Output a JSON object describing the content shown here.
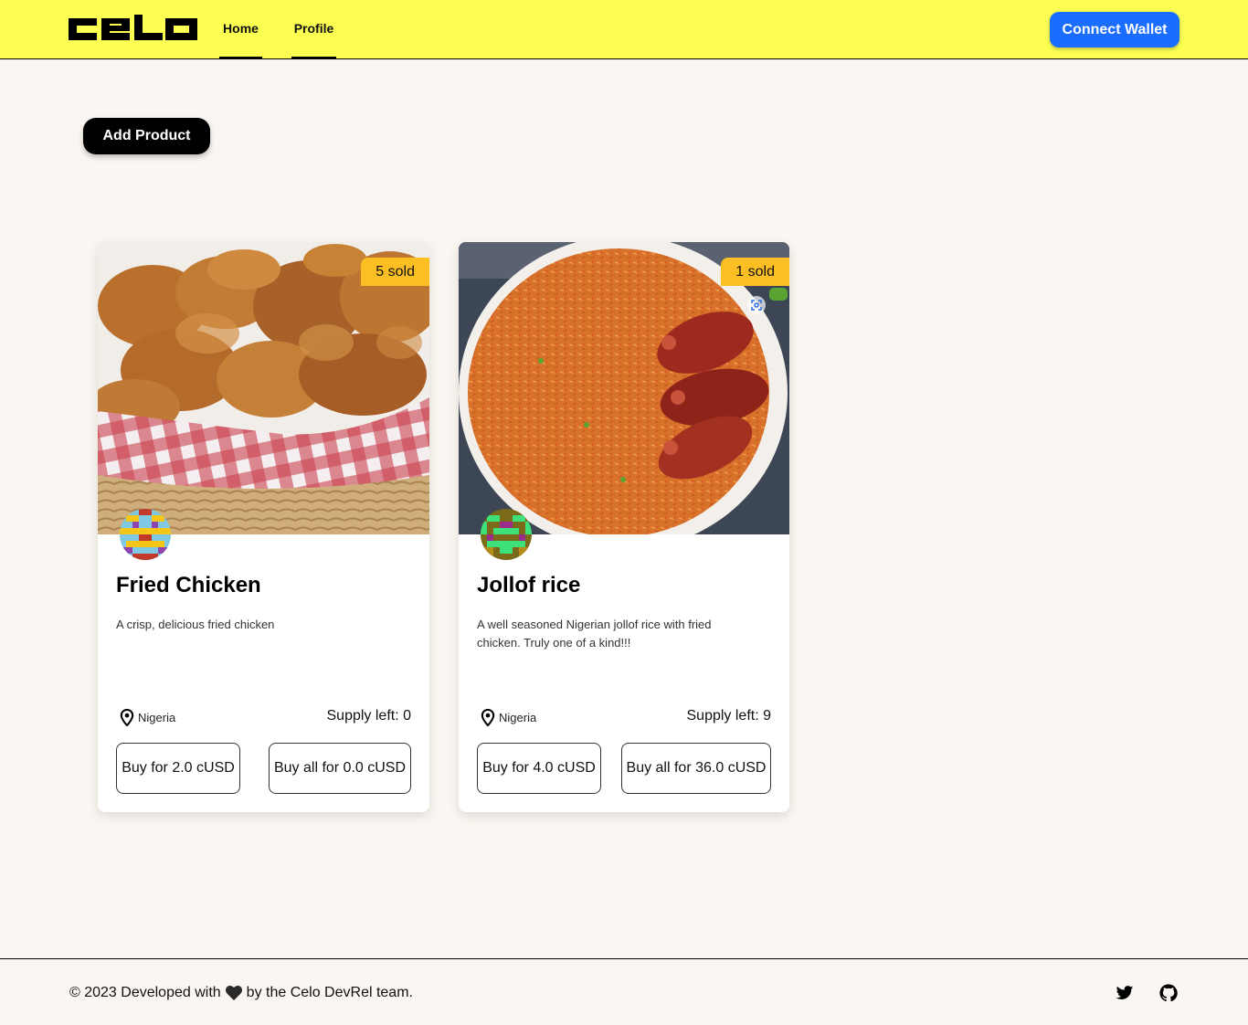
{
  "header": {
    "logo": "Celo",
    "nav": [
      {
        "label": "Home"
      },
      {
        "label": "Profile"
      }
    ],
    "connect_label": "Connect Wallet",
    "bg_color": "#fcff52",
    "accent_color": "#1a6dff"
  },
  "main": {
    "add_product_label": "Add Product"
  },
  "products": [
    {
      "name": "Fried Chicken",
      "sold": "5 sold",
      "description": "A crisp, delicious fried chicken",
      "location": "Nigeria",
      "supply": "Supply left: 0",
      "buy_label": "Buy for 2.0 cUSD",
      "buy_all_label": "Buy all for 0.0 cUSD",
      "image_icon": "fried-chicken-photo"
    },
    {
      "name": "Jollof rice",
      "sold": "1 sold",
      "description": "A well seasoned Nigerian jollof rice with fried chicken. Truly one of a kind!!!",
      "location": "Nigeria",
      "supply": "Supply left: 9",
      "buy_label": "Buy for 4.0 cUSD",
      "buy_all_label": "Buy all for 36.0 cUSD",
      "image_icon": "jollof-rice-photo"
    }
  ],
  "footer": {
    "text_before": "© 2023 Developed with",
    "text_after": "by the Celo DevRel team.",
    "icons": [
      "heart-icon",
      "twitter-icon",
      "github-icon"
    ]
  }
}
